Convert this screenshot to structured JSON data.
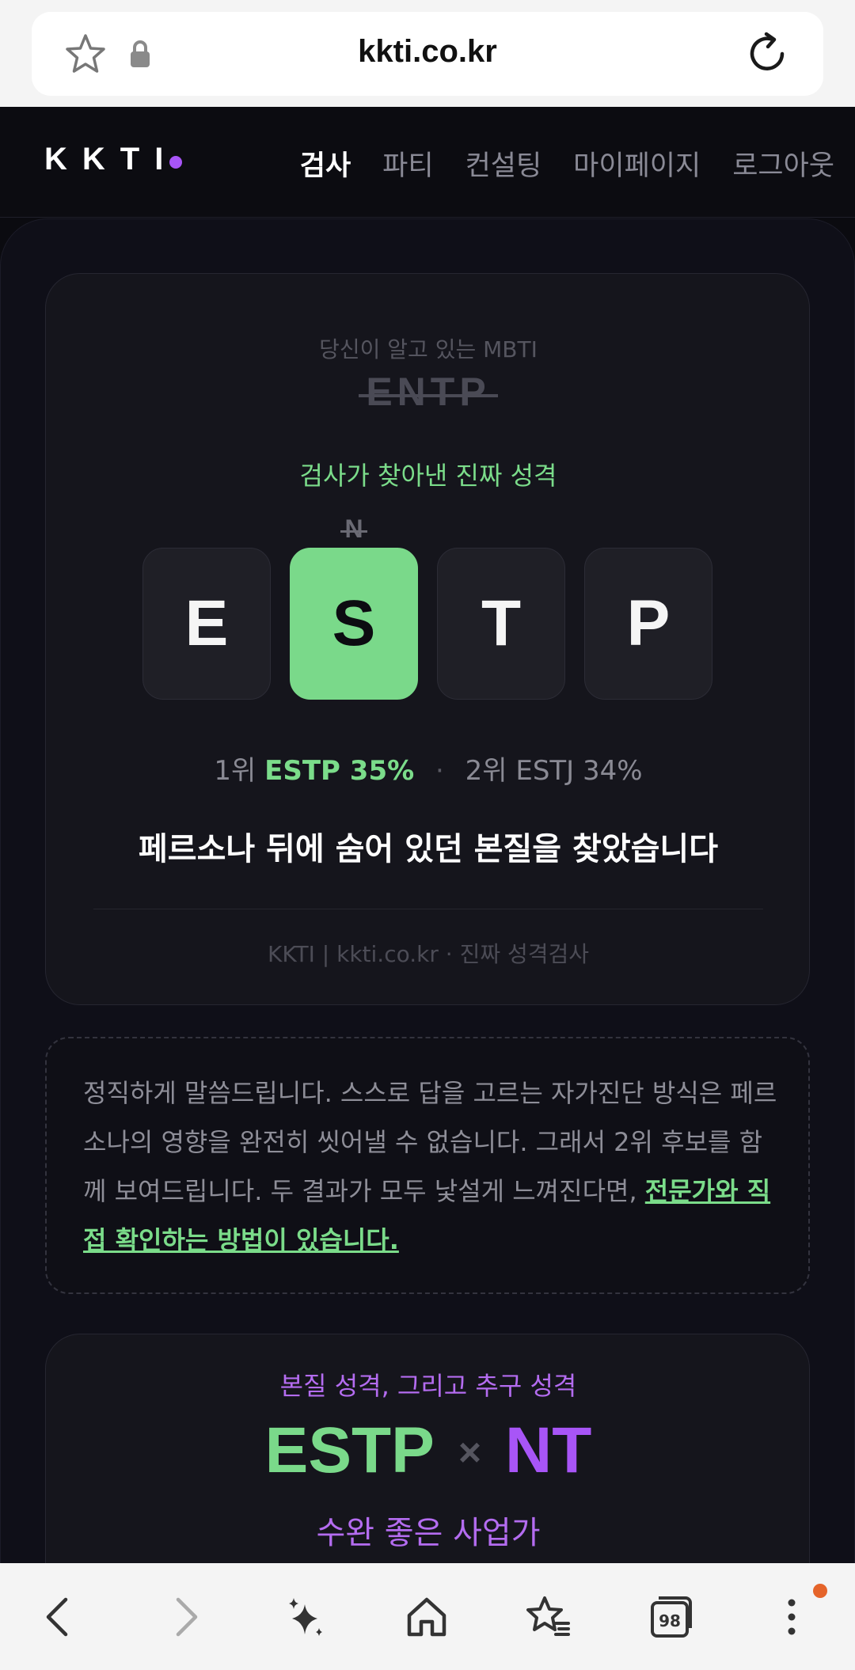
{
  "browser": {
    "url": "kkti.co.kr",
    "tab_count": "98",
    "icons": [
      "star-icon",
      "lock-icon",
      "reload-icon",
      "back-icon",
      "forward-icon",
      "sparkle-icon",
      "home-icon",
      "bookmarks-icon",
      "tabs-icon",
      "more-icon"
    ]
  },
  "header": {
    "logo": "KKTI",
    "nav": [
      "검사",
      "파티",
      "컨설팅",
      "마이페이지",
      "로그아웃"
    ],
    "active_nav": "검사"
  },
  "result": {
    "known_label": "당신이 알고 있는 MBTI",
    "known_type": "ENTP",
    "found_label": "검사가 찾아낸 진짜 성격",
    "letters": [
      "E",
      "S",
      "T",
      "P"
    ],
    "changed_from": "N",
    "rank1_prefix": "1위",
    "rank1_value": "ESTP 35%",
    "separator": "·",
    "rank2": "2위 ESTJ 34%",
    "tagline": "페르소나 뒤에 숨어 있던 본질을 찾았습니다",
    "footer": "KKTI | kkti.co.kr · 진짜 성격검사"
  },
  "note": {
    "text": "정직하게 말씀드립니다. 스스로 답을 고르는 자가진단 방식은 페르소나의 영향을 완전히 씻어낼 수 없습니다. 그래서 2위 후보를 함께 보여드립니다. 두 결과가 모두 낯설게 느껴진다면, ",
    "link": "전문가와 직접 확인하는 방법이 있습니다."
  },
  "pursuit": {
    "label": "본질 성격, 그리고 추구 성격",
    "essence": "ESTP",
    "times": "×",
    "pursuit": "NT",
    "subtitle": "수완 좋은 사업가"
  },
  "colors": {
    "accent_green": "#7ad98a",
    "accent_purple": "#a855f7",
    "background": "#0f0f18"
  }
}
